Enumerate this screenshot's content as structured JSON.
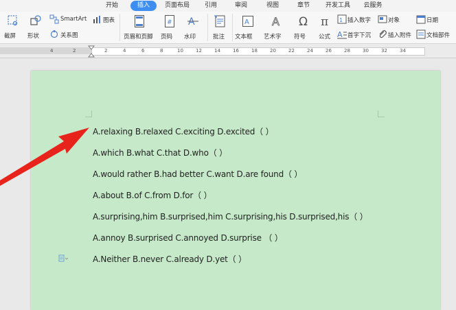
{
  "tabs": [
    {
      "label": "开始"
    },
    {
      "label": "插入",
      "active": true
    },
    {
      "label": "页面布局"
    },
    {
      "label": "引用"
    },
    {
      "label": "审阅"
    },
    {
      "label": "视图"
    },
    {
      "label": "章节"
    },
    {
      "label": "开发工具"
    },
    {
      "label": "云服务"
    }
  ],
  "toolbar": {
    "screenshot": "截屏",
    "shapes": "形状",
    "smartart": "SmartArt",
    "chart": "图表",
    "relation": "关系图",
    "header_footer": "页眉和页脚",
    "page_number": "页码",
    "watermark": "水印",
    "comment": "批注",
    "textbox": "文本框",
    "wordart": "艺术字",
    "symbol": "符号",
    "formula": "公式",
    "insert_number": "插入数字",
    "dropcap": "首字下沉",
    "object": "对象",
    "attachment": "插入附件",
    "date": "日期",
    "doc_parts": "文档部件"
  },
  "ruler": {
    "labels": [
      "4",
      "2",
      "2",
      "4",
      "6",
      "8",
      "10",
      "12",
      "14",
      "16",
      "18",
      "20",
      "22",
      "24",
      "26",
      "28",
      "30",
      "32",
      "34"
    ]
  },
  "document": {
    "lines": [
      "A.relaxing  B.relaxed  C.exciting  D.excited（    ）",
      "A.which  B.what  C.that  D.who（    ）",
      "A.would  rather  B.had  better  C.want  D.are  found（    ）",
      "A.about  B.of  C.from  D.for（    ）",
      "A.surprising,him  B.surprised,him  C.surprising,his  D.surprised,his（    ）",
      "A.annoy  B.surprised  C.annoyed  D.surprise   （    ）",
      "A.Neither  B.never  C.already  D.yet（    ）"
    ]
  },
  "colors": {
    "accent": "#3d8ef0",
    "page_bg": "#c6eac9",
    "arrow": "#e8231b"
  }
}
